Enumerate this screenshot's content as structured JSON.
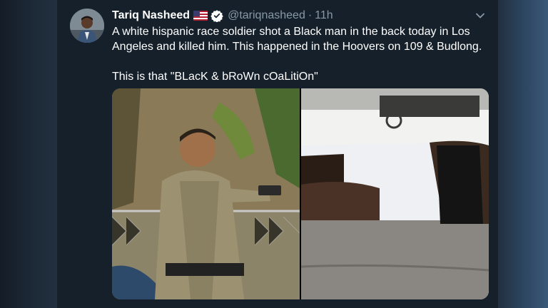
{
  "tweet": {
    "display_name": "Tariq Nasheed",
    "handle": "@tariqnasheed",
    "separator": "·",
    "time": "11h",
    "text": "A white hispanic race soldier shot a Black man in the back today in Los Angeles and killed him. This happened in the Hoovers on 109 & Budlong.\n\nThis is that \"BLacK & bRoWn cOaLitiOn\"",
    "icons": {
      "flag": "us-flag-icon",
      "verified": "verified-badge-icon",
      "more": "chevron-down-icon"
    },
    "colors": {
      "background": "#15202b",
      "text": "#ffffff",
      "secondary_text": "#8899a6",
      "verified": "#ffffff"
    }
  }
}
